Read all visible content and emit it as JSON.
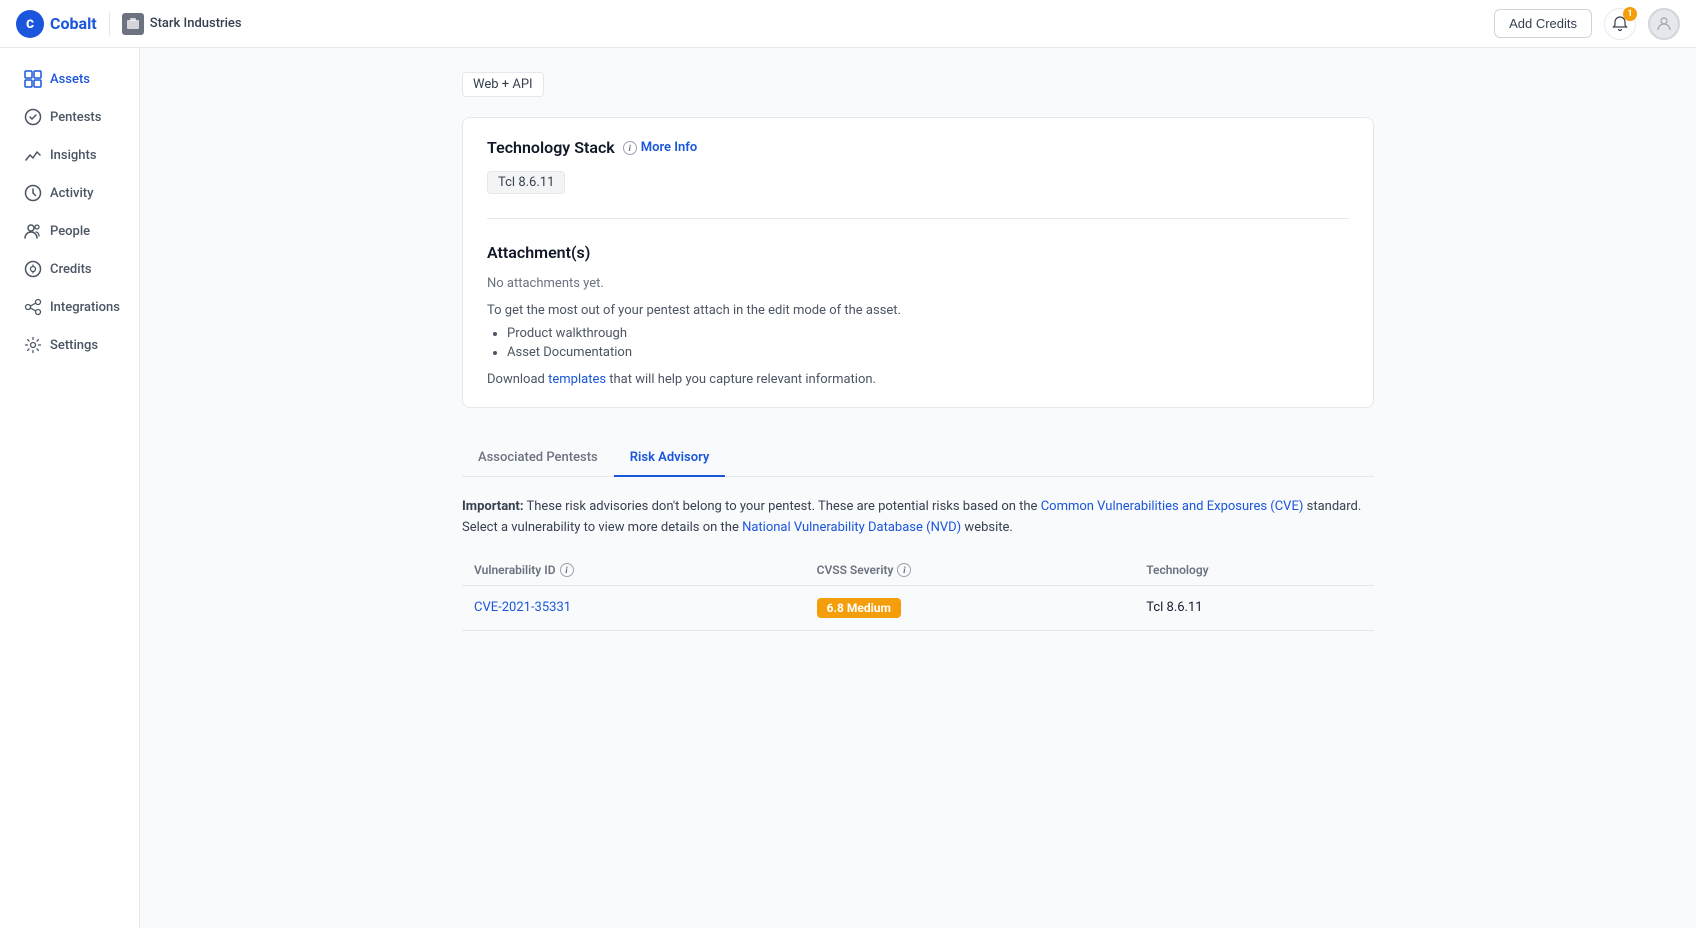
{
  "topnav": {
    "logo_text": "Cobalt",
    "company_name": "Stark Industries",
    "add_credits_label": "Add Credits",
    "notification_count": "1"
  },
  "sidebar": {
    "items": [
      {
        "id": "assets",
        "label": "Assets",
        "active": true
      },
      {
        "id": "pentests",
        "label": "Pentests",
        "active": false
      },
      {
        "id": "insights",
        "label": "Insights",
        "active": false
      },
      {
        "id": "activity",
        "label": "Activity",
        "active": false
      },
      {
        "id": "people",
        "label": "People",
        "active": false
      },
      {
        "id": "credits",
        "label": "Credits",
        "active": false
      },
      {
        "id": "integrations",
        "label": "Integrations",
        "active": false
      },
      {
        "id": "settings",
        "label": "Settings",
        "active": false
      }
    ]
  },
  "asset": {
    "type": "Web + API",
    "technology_stack": {
      "title": "Technology Stack",
      "more_info_label": "More Info",
      "tech_item": "Tcl 8.6.11"
    },
    "attachments": {
      "title": "Attachment(s)",
      "no_attachments_text": "No attachments yet.",
      "description": "To get the most out of your pentest attach in the edit mode of the asset.",
      "list_items": [
        "Product walkthrough",
        "Asset Documentation"
      ],
      "footer_text": "Download ",
      "footer_link_text": "templates",
      "footer_suffix": " that will help you capture relevant information."
    }
  },
  "tabs": {
    "items": [
      {
        "id": "associated-pentests",
        "label": "Associated Pentests",
        "active": false
      },
      {
        "id": "risk-advisory",
        "label": "Risk Advisory",
        "active": true
      }
    ]
  },
  "risk_advisory": {
    "notice_bold": "Important:",
    "notice_text": " These risk advisories don't belong to your pentest. These are potential risks based on the ",
    "cve_link_text": "Common Vulnerabilities and Exposures (CVE)",
    "notice_text2": " standard.",
    "notice_line2": "Select a vulnerability to view more details on the ",
    "nvd_link_text": "National Vulnerability Database (NVD)",
    "notice_text3": " website.",
    "table": {
      "headers": [
        {
          "label": "Vulnerability ID",
          "has_info": true
        },
        {
          "label": "CVSS Severity",
          "has_info": true
        },
        {
          "label": "Technology",
          "has_info": false
        }
      ],
      "rows": [
        {
          "vuln_id": "CVE-2021-35331",
          "severity_label": "6.8 Medium",
          "severity_class": "medium",
          "technology": "Tcl 8.6.11"
        }
      ]
    }
  }
}
